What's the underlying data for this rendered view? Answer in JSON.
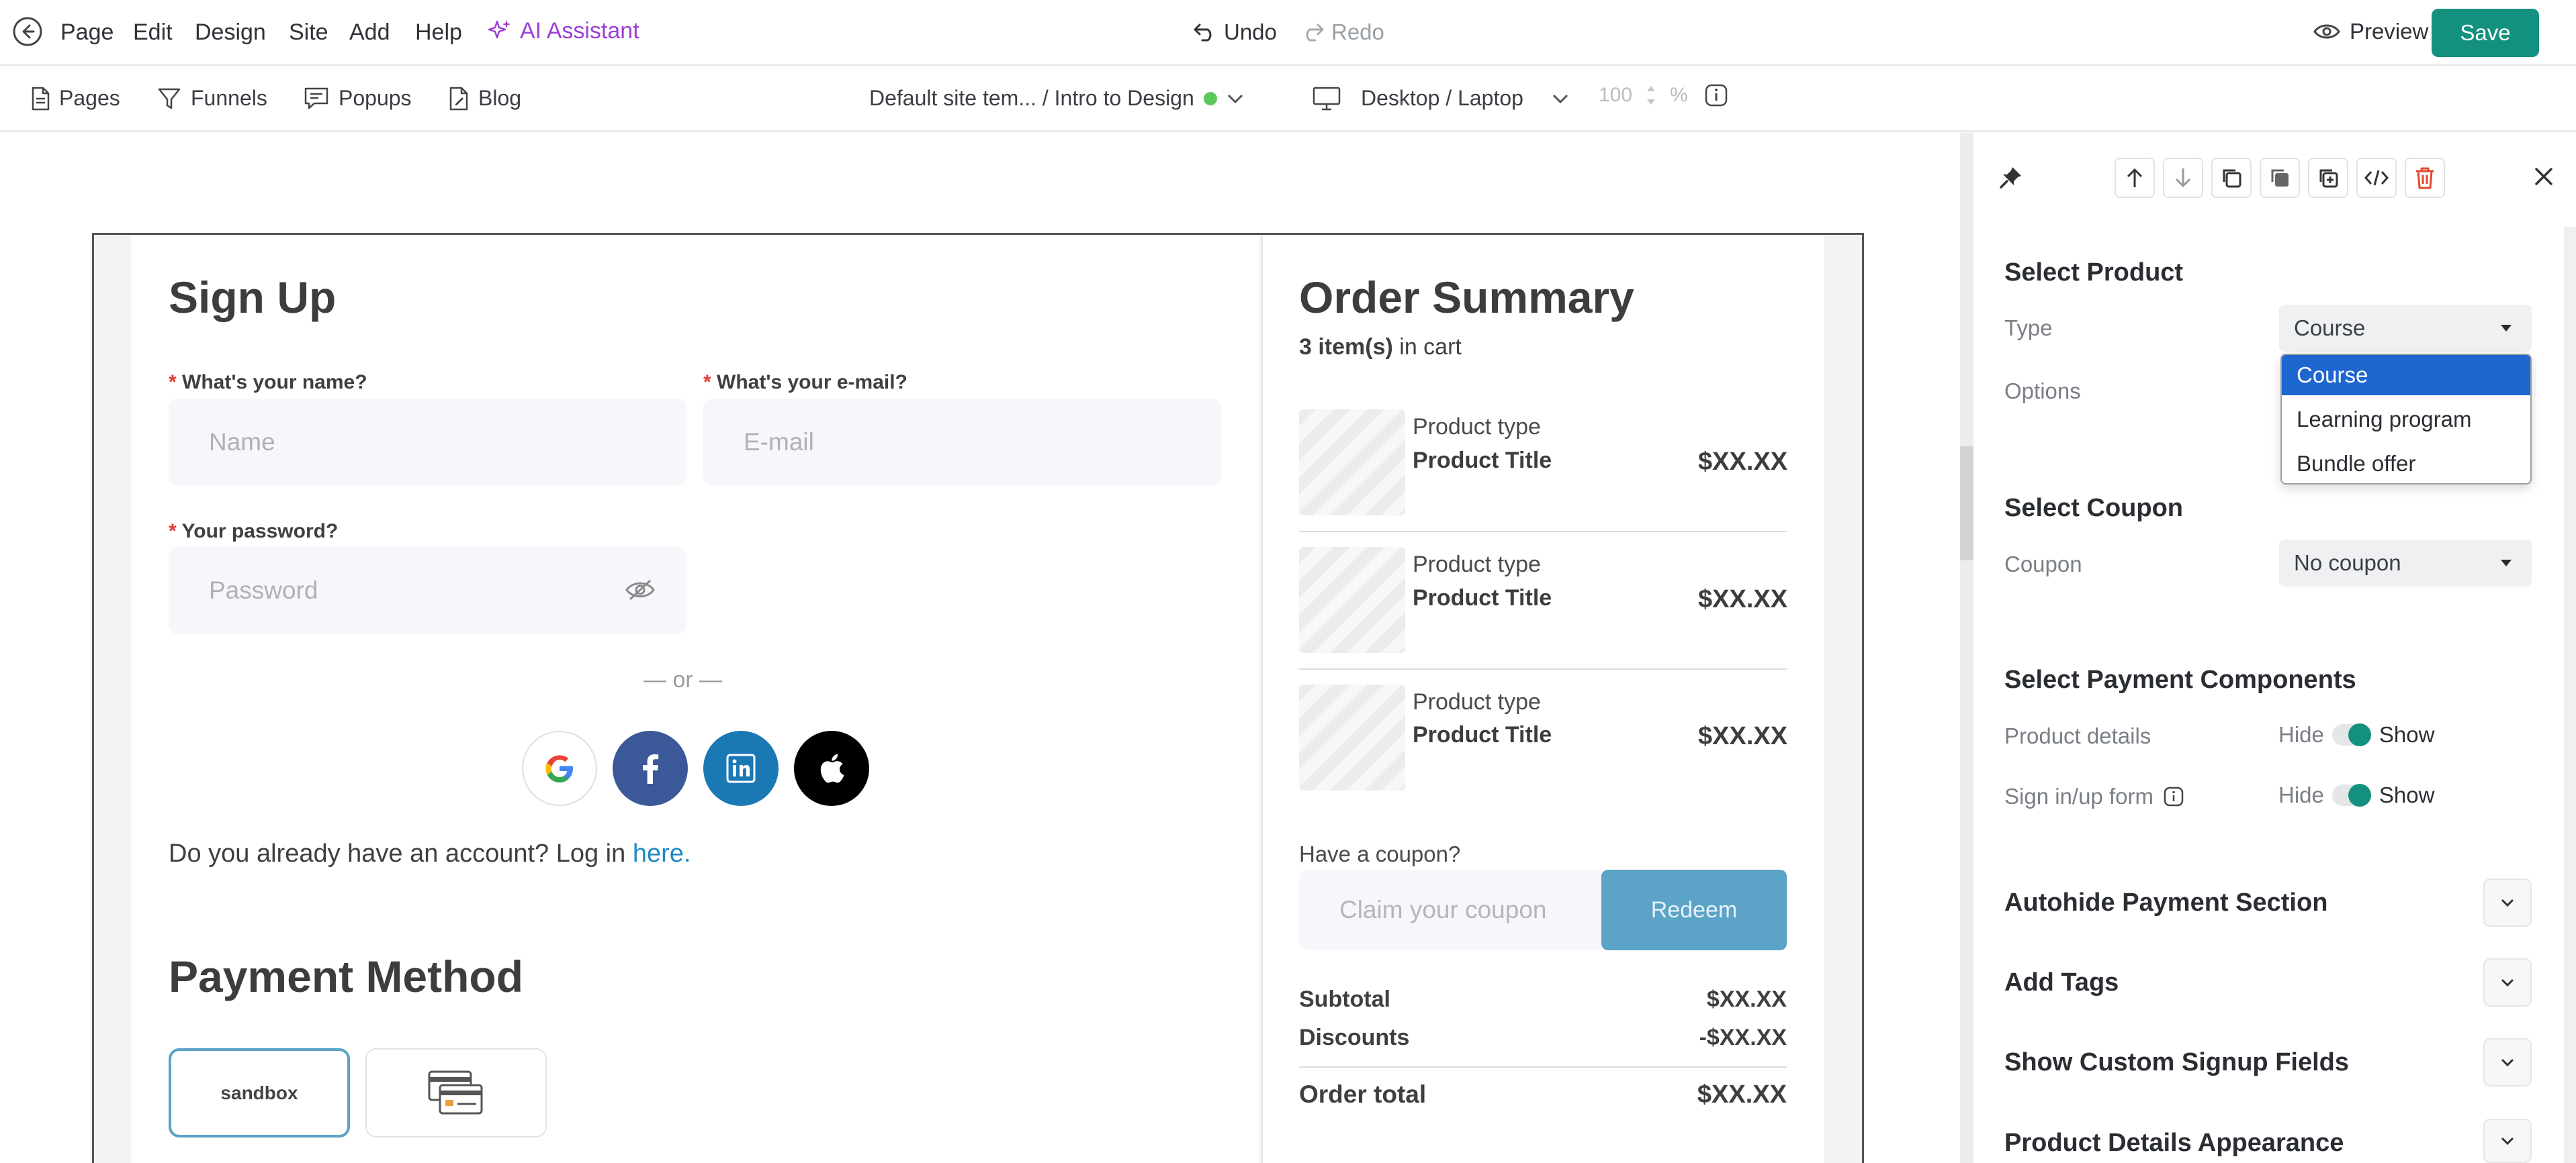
{
  "topbar": {
    "menu": [
      "Page",
      "Edit",
      "Design",
      "Site",
      "Add",
      "Help"
    ],
    "ai_assistant": "AI Assistant",
    "undo": "Undo",
    "redo": "Redo",
    "preview": "Preview",
    "save": "Save"
  },
  "subbar": {
    "pages": "Pages",
    "funnels": "Funnels",
    "popups": "Popups",
    "blog": "Blog",
    "template_path": "Default site tem... / Intro to Design",
    "device": "Desktop / Laptop",
    "zoom": "100",
    "zoom_unit": "%"
  },
  "signup": {
    "title": "Sign Up",
    "name_label": "What's your name?",
    "name_placeholder": "Name",
    "email_label": "What's your e-mail?",
    "email_placeholder": "E-mail",
    "password_label": "Your password?",
    "password_placeholder": "Password",
    "required_mark": "*",
    "or_text": "— or —",
    "login_prefix": "Do you already have an account? Log in ",
    "login_link": "here."
  },
  "payment": {
    "title": "Payment Method",
    "sandbox": "sandbox"
  },
  "order": {
    "title": "Order Summary",
    "items_count": "3 item(s)",
    "items_suffix": " in cart",
    "products": [
      {
        "type": "Product type",
        "title": "Product Title",
        "price": "$XX.XX"
      },
      {
        "type": "Product type",
        "title": "Product Title",
        "price": "$XX.XX"
      },
      {
        "type": "Product type",
        "title": "Product Title",
        "price": "$XX.XX"
      }
    ],
    "coupon_label": "Have a coupon?",
    "coupon_placeholder": "Claim your coupon",
    "redeem": "Redeem",
    "subtotal_label": "Subtotal",
    "subtotal_value": "$XX.XX",
    "discounts_label": "Discounts",
    "discounts_value": "-$XX.XX",
    "total_label": "Order total",
    "total_value": "$XX.XX"
  },
  "panel": {
    "select_product": "Select Product",
    "type_label": "Type",
    "type_value": "Course",
    "options_label": "Options",
    "dropdown_options": [
      "Course",
      "Learning program",
      "Bundle offer"
    ],
    "select_coupon": "Select Coupon",
    "coupon_label": "Coupon",
    "coupon_value": "No coupon",
    "payment_components": "Select Payment Components",
    "product_details": "Product details",
    "signin_form": "Sign in/up form",
    "hide": "Hide",
    "show": "Show",
    "accordions": [
      "Autohide Payment Section",
      "Add Tags",
      "Show Custom Signup Fields",
      "Product Details Appearance"
    ]
  },
  "colors": {
    "accent": "#13907e",
    "ai_purple": "#9b3fd6",
    "link_blue": "#1e88c8",
    "redeem_blue": "#5ba3c7",
    "select_blue": "#1e66d0",
    "delete_red": "#e0492f"
  }
}
